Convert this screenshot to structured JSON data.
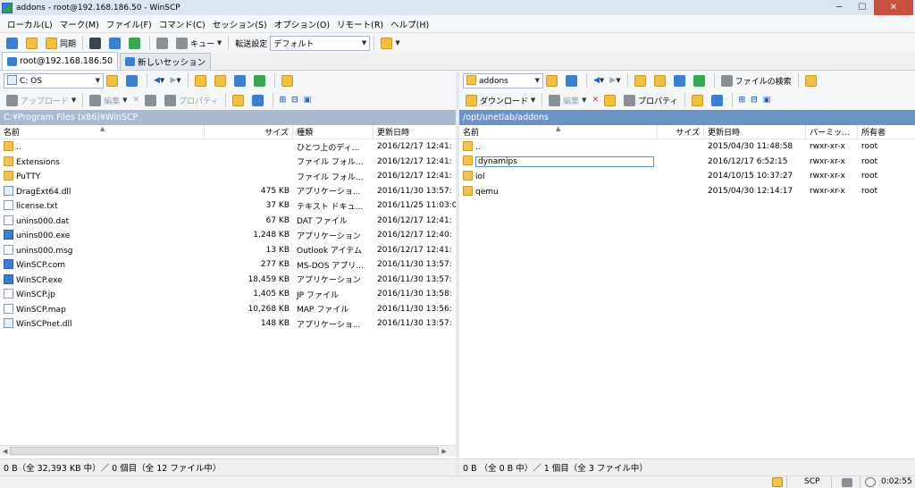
{
  "window": {
    "title": "addons - root@192.168.186.50 - WinSCP"
  },
  "menu": [
    "ローカル(L)",
    "マーク(M)",
    "ファイル(F)",
    "コマンド(C)",
    "セッション(S)",
    "オプション(O)",
    "リモート(R)",
    "ヘルプ(H)"
  ],
  "toolbar": {
    "sync_label": "同期",
    "queue_label": "キュー",
    "transfer_label": "転送設定",
    "transfer_value": "デフォルト"
  },
  "tabs": [
    {
      "label": "root@192.168.186.50"
    },
    {
      "label": "新しいセッション"
    }
  ],
  "left": {
    "drive": "C: OS",
    "upload_label": "アップロード",
    "edit_label": "編集",
    "props_label": "プロパティ",
    "path": "C:¥Program Files (x86)¥WinSCP",
    "columns": [
      "名前",
      "サイズ",
      "種類",
      "更新日時"
    ],
    "rows": [
      {
        "name": "..",
        "size": "",
        "type": "ひとつ上のディ...",
        "date": "2016/12/17  12:41:"
      },
      {
        "name": "Extensions",
        "size": "",
        "type": "ファイル フォル...",
        "date": "2016/12/17  12:41:"
      },
      {
        "name": "PuTTY",
        "size": "",
        "type": "ファイル フォル...",
        "date": "2016/12/17  12:41:"
      },
      {
        "name": "DragExt64.dll",
        "size": "475 KB",
        "type": "アプリケーショ...",
        "date": "2016/11/30  13:57:"
      },
      {
        "name": "license.txt",
        "size": "37 KB",
        "type": "テキスト ドキュ...",
        "date": "2016/11/25  11:03:0"
      },
      {
        "name": "unins000.dat",
        "size": "67 KB",
        "type": "DAT ファイル",
        "date": "2016/12/17  12:41:"
      },
      {
        "name": "unins000.exe",
        "size": "1,248 KB",
        "type": "アプリケーション",
        "date": "2016/12/17  12:40:"
      },
      {
        "name": "unins000.msg",
        "size": "13 KB",
        "type": "Outlook アイテム",
        "date": "2016/12/17  12:41:"
      },
      {
        "name": "WinSCP.com",
        "size": "277 KB",
        "type": "MS-DOS アプリ...",
        "date": "2016/11/30  13:57:"
      },
      {
        "name": "WinSCP.exe",
        "size": "18,459 KB",
        "type": "アプリケーション",
        "date": "2016/11/30  13:57:"
      },
      {
        "name": "WinSCP.jp",
        "size": "1,405 KB",
        "type": "JP ファイル",
        "date": "2016/11/30  13:58:"
      },
      {
        "name": "WinSCP.map",
        "size": "10,268 KB",
        "type": "MAP ファイル",
        "date": "2016/11/30  13:56:"
      },
      {
        "name": "WinSCPnet.dll",
        "size": "148 KB",
        "type": "アプリケーショ...",
        "date": "2016/11/30  13:57:"
      }
    ],
    "status": "0 B（全 32,393 KB 中）／ 0 個目（全 12 ファイル中）"
  },
  "right": {
    "folder": "addons",
    "search_label": "ファイルの検索",
    "download_label": "ダウンロード",
    "edit_label": "編集",
    "props_label": "プロパティ",
    "path": "/opt/unetlab/addons",
    "columns": [
      "名前",
      "サイズ",
      "更新日時",
      "パーミッ...",
      "所有者"
    ],
    "rows": [
      {
        "name": "..",
        "size": "",
        "date": "2015/04/30 11:48:58",
        "perm": "rwxr-xr-x",
        "owner": "root"
      },
      {
        "name": "dynamips",
        "size": "",
        "date": "2016/12/17 6:52:15",
        "perm": "rwxr-xr-x",
        "owner": "root"
      },
      {
        "name": "iol",
        "size": "",
        "date": "2014/10/15 10:37:27",
        "perm": "rwxr-xr-x",
        "owner": "root"
      },
      {
        "name": "qemu",
        "size": "",
        "date": "2015/04/30 12:14:17",
        "perm": "rwxr-xr-x",
        "owner": "root"
      }
    ],
    "status": "0 B （全 0 B 中）／ 1 個目（全 3 ファイル中）"
  },
  "bottom": {
    "protocol": "SCP",
    "time": "0:02:55"
  }
}
